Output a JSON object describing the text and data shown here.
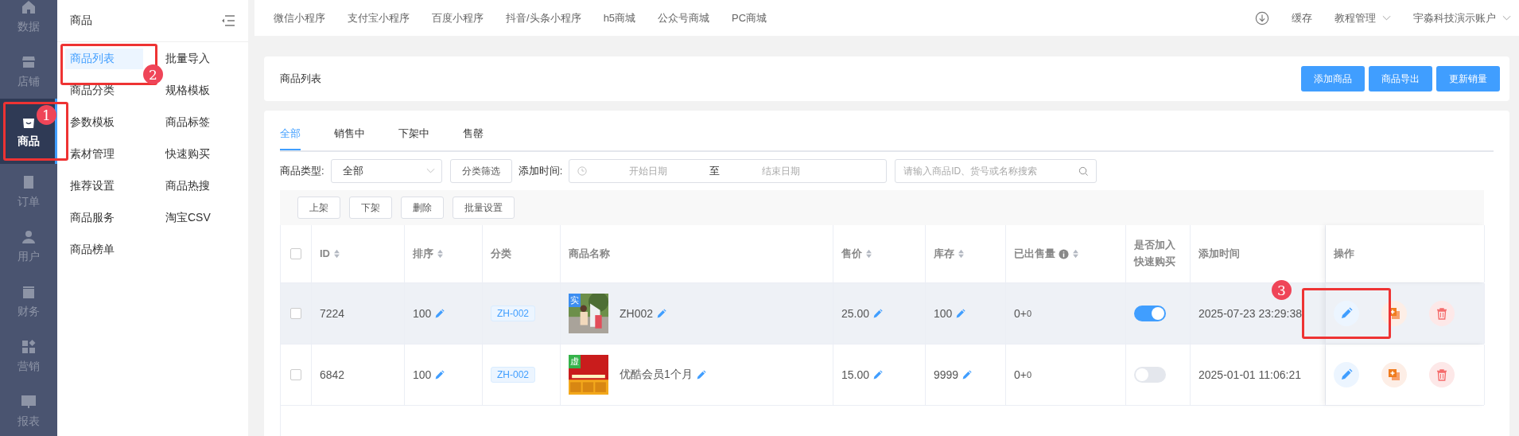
{
  "rail": [
    {
      "label": "数据",
      "selected": false
    },
    {
      "label": "店铺",
      "selected": false
    },
    {
      "label": "商品",
      "selected": true,
      "callout": "1"
    },
    {
      "label": "订单",
      "selected": false
    },
    {
      "label": "用户",
      "selected": false
    },
    {
      "label": "财务",
      "selected": false
    },
    {
      "label": "营销",
      "selected": false
    },
    {
      "label": "报表",
      "selected": false
    }
  ],
  "submenu": {
    "title": "商品",
    "items": [
      {
        "label": "商品列表",
        "selected": true,
        "callout": "2"
      },
      {
        "label": "批量导入",
        "selected": false
      },
      {
        "label": "商品分类",
        "selected": false
      },
      {
        "label": "规格模板",
        "selected": false
      },
      {
        "label": "参数模板",
        "selected": false
      },
      {
        "label": "商品标签",
        "selected": false
      },
      {
        "label": "素材管理",
        "selected": false
      },
      {
        "label": "快速购买",
        "selected": false
      },
      {
        "label": "推荐设置",
        "selected": false
      },
      {
        "label": "商品热搜",
        "selected": false
      },
      {
        "label": "商品服务",
        "selected": false
      },
      {
        "label": "淘宝CSV",
        "selected": false
      },
      {
        "label": "商品榜单",
        "selected": false
      }
    ]
  },
  "top_nav": {
    "links": [
      "微信小程序",
      "支付宝小程序",
      "百度小程序",
      "抖音/头条小程序",
      "h5商城",
      "公众号商城",
      "PC商城"
    ],
    "right": [
      {
        "kind": "download"
      },
      {
        "kind": "plain",
        "label": "缓存"
      },
      {
        "kind": "dropdown",
        "label": "教程管理"
      },
      {
        "kind": "dropdown",
        "label": "宇淼科技演示账户"
      }
    ]
  },
  "page_header": {
    "title": "商品列表",
    "buttons": [
      "添加商品",
      "商品导出",
      "更新销量"
    ]
  },
  "tabs": [
    {
      "label": "全部",
      "selected": true
    },
    {
      "label": "销售中",
      "selected": false
    },
    {
      "label": "下架中",
      "selected": false
    },
    {
      "label": "售罄",
      "selected": false
    }
  ],
  "filters": {
    "type_label": "商品类型:",
    "type_value": "全部",
    "category_button": "分类筛选",
    "time_label": "添加时间:",
    "start_placeholder": "开始日期",
    "separator": "至",
    "end_placeholder": "结束日期",
    "search_placeholder": "请输入商品ID、货号或名称搜索"
  },
  "bulk_actions": [
    "上架",
    "下架",
    "删除",
    "批量设置"
  ],
  "table": {
    "all_checked": false,
    "columns": [
      {
        "label": "ID",
        "sortable": true
      },
      {
        "label": "排序",
        "sortable": true
      },
      {
        "label": "分类",
        "sortable": false
      },
      {
        "label": "商品名称",
        "sortable": false
      },
      {
        "label": "售价",
        "sortable": true
      },
      {
        "label": "库存",
        "sortable": true
      },
      {
        "label": "已出售量",
        "sortable": true,
        "info": true
      },
      {
        "label": "是否加入快速购买",
        "sortable": false
      },
      {
        "label": "添加时间",
        "sortable": false
      },
      {
        "label": "操作",
        "sortable": false
      }
    ],
    "rows": [
      {
        "checked": false,
        "highlighted": true,
        "id": "7224",
        "sort": "100",
        "category": "ZH-002",
        "thumb": {
          "tag": "实",
          "color": "#3d8ef0"
        },
        "name": "ZH002",
        "price": "25.00",
        "stock": "100",
        "sold": "0+",
        "sold_extra": "0",
        "quick_buy": true,
        "added": "2025-07-23 23:29:38",
        "edit_callout": "3"
      },
      {
        "checked": false,
        "highlighted": false,
        "id": "6842",
        "sort": "100",
        "category": "ZH-002",
        "thumb": {
          "tag": "虚",
          "color": "#35b24a"
        },
        "name": "优酷会员1个月",
        "price": "15.00",
        "stock": "9999",
        "sold": "0+",
        "sold_extra": "0",
        "quick_buy": false,
        "added": "2025-01-01 11:06:21"
      }
    ]
  }
}
